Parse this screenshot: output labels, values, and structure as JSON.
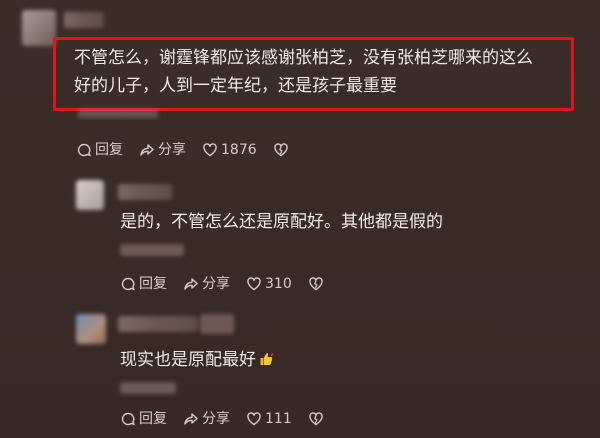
{
  "colors": {
    "background": "#3a2b27",
    "highlight_border": "#e0141f",
    "text": "#f2ebe8",
    "action_text": "#d8ccc9"
  },
  "comments": [
    {
      "line1": "不管怎么，谢霆锋都应该感谢张柏芝，没有张柏芝哪来的这么",
      "line2": "好的儿子，人到一定年纪，还是孩子最重要",
      "actions": {
        "reply": "回复",
        "share": "分享",
        "likes": "1876"
      }
    },
    {
      "text": "是的，不管怎么还是原配好。其他都是假的",
      "actions": {
        "reply": "回复",
        "share": "分享",
        "likes": "310"
      }
    },
    {
      "text": "现实也是原配最好",
      "emoji": "thumbs-up-icon",
      "actions": {
        "reply": "回复",
        "share": "分享",
        "likes": "111"
      }
    }
  ]
}
